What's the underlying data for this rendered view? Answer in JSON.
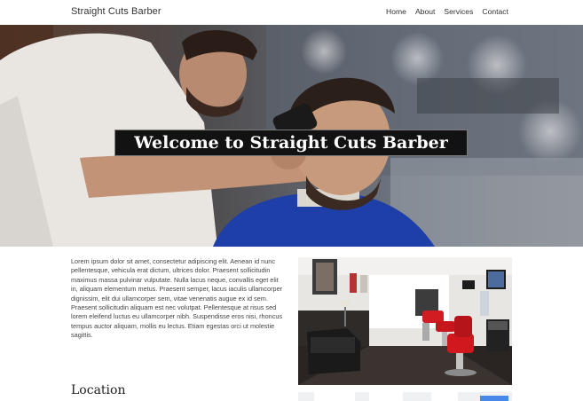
{
  "navbar": {
    "brand": "Straight Cuts Barber",
    "links": [
      "Home",
      "About",
      "Services",
      "Contact"
    ]
  },
  "hero": {
    "title": "Welcome to Straight Cuts Barber"
  },
  "content": {
    "about_text": "Lorem ipsum dolor sit amet, consectetur adipiscing elit. Aenean id nunc pellentesque, vehicula erat dictum, ultrices dolor. Praesent sollicitudin maximus massa pulvinar vulputate. Nulla lacus neque, convallis eget elit in, aliquam elementum metus. Praesent semper, lacus iaculis ullamcorper dignissim, elit dui ullamcorper sem, vitae venenatis augue ex id sem. Praesent sollicitudin aliquam est nec volutpat. Pellentesque at risus sed lorem eleifend luctus eu ullamcorper nibh. Suspendisse eros nisi, rhoncus tempus auctor aliquam, mollis eu lectus. Etiam egestas orci ut molestie sagittis.",
    "location_heading": "Location"
  }
}
